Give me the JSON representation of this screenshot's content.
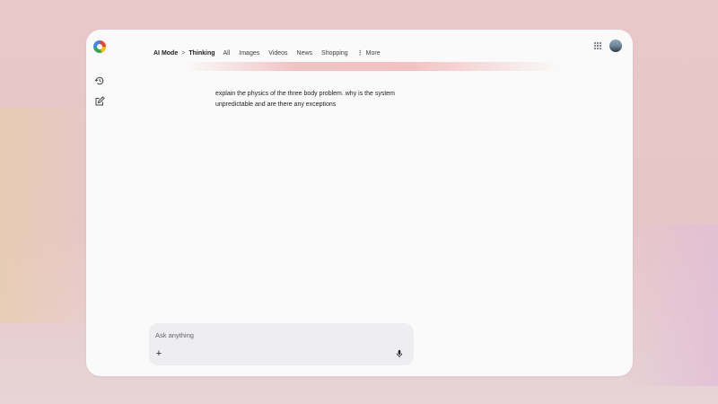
{
  "header": {
    "mode_label": "AI Mode",
    "breadcrumb_sep": ">",
    "thinking_label": "Thinking",
    "tabs": [
      "All",
      "Images",
      "Videos",
      "News",
      "Shopping"
    ],
    "more_label": "More",
    "more_dots": "⋮"
  },
  "sidebar": {
    "items": [
      {
        "name": "history",
        "icon": "history-icon"
      },
      {
        "name": "new-chat",
        "icon": "edit-icon"
      }
    ]
  },
  "chat": {
    "query_text": "explain the physics of the three body problem. why is the system unpredictable and are there any exceptions"
  },
  "composer": {
    "placeholder": "Ask anything",
    "add_symbol": "+"
  },
  "colors": {
    "background": "#e9c8c9",
    "window": "#fafafa",
    "composer": "#eeeef0",
    "text": "#202124"
  }
}
